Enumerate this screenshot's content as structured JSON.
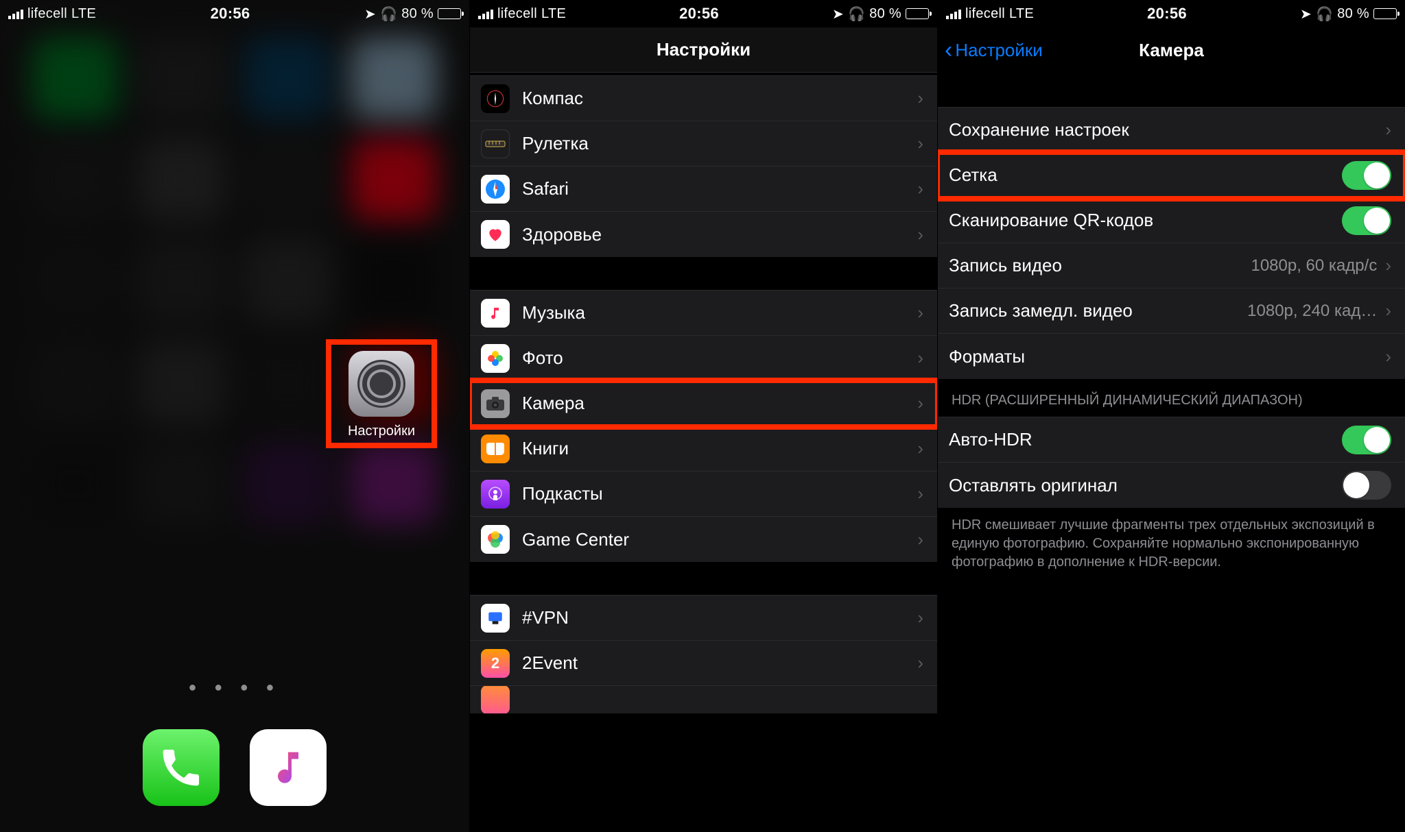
{
  "statusBar": {
    "carrier": "lifecell",
    "network": "LTE",
    "time": "20:56",
    "batteryPct": "80 %"
  },
  "panel1": {
    "appLabel": "Настройки"
  },
  "panel2": {
    "title": "Настройки",
    "groups": [
      {
        "items": [
          {
            "key": "compass",
            "label": "Компас"
          },
          {
            "key": "measure",
            "label": "Рулетка"
          },
          {
            "key": "safari",
            "label": "Safari"
          },
          {
            "key": "health",
            "label": "Здоровье"
          }
        ]
      },
      {
        "items": [
          {
            "key": "music",
            "label": "Музыка"
          },
          {
            "key": "photos",
            "label": "Фото"
          },
          {
            "key": "camera",
            "label": "Камера",
            "highlight": true
          },
          {
            "key": "books",
            "label": "Книги"
          },
          {
            "key": "podcasts",
            "label": "Подкасты"
          },
          {
            "key": "gamecenter",
            "label": "Game Center"
          }
        ]
      },
      {
        "items": [
          {
            "key": "vpn",
            "label": "#VPN"
          },
          {
            "key": "2event",
            "label": "2Event"
          }
        ]
      }
    ]
  },
  "panel3": {
    "back": "Настройки",
    "title": "Камера",
    "rows": {
      "preserve": "Сохранение настроек",
      "grid": "Сетка",
      "qr": "Сканирование QR-кодов",
      "recordVideoLabel": "Запись видео",
      "recordVideoValue": "1080p, 60 кадр/с",
      "slowmoLabel": "Запись замедл. видео",
      "slowmoValue": "1080p, 240 кад…",
      "formats": "Форматы",
      "hdrHeader": "HDR (РАСШИРЕННЫЙ ДИНАМИЧЕСКИЙ ДИАПАЗОН)",
      "autoHdr": "Авто-HDR",
      "keepOriginal": "Оставлять оригинал",
      "hdrFooter": "HDR смешивает лучшие фрагменты трех отдельных экспозиций в единую фотографию. Сохраняйте нормально экспонированную фотографию в дополнение к HDR-версии."
    },
    "toggles": {
      "grid": true,
      "qr": true,
      "autoHdr": true,
      "keepOriginal": false
    }
  }
}
